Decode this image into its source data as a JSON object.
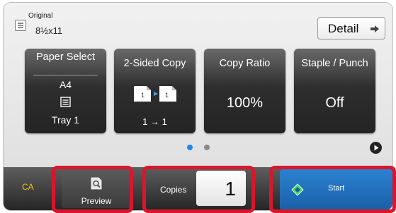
{
  "original": {
    "label": "Original",
    "size": "8½x11",
    "icon": "document-icon"
  },
  "detail": {
    "label": "Detail",
    "icon": "arrow-right-icon"
  },
  "tiles": [
    {
      "title": "Paper Select",
      "subtitle": "A4",
      "icon": "paper-tray-icon",
      "value": "Tray 1"
    },
    {
      "title": "2-Sided Copy",
      "icon": "duplex-icon",
      "value": "1 → 1"
    },
    {
      "title": "Copy Ratio",
      "value": "100%"
    },
    {
      "title": "Staple / Punch",
      "value": "Off"
    }
  ],
  "pagination": {
    "pages": 2,
    "current": 1,
    "next_icon": "play-icon"
  },
  "bottom": {
    "ca_label": "CA",
    "preview_label": "Preview",
    "preview_icon": "magnifier-document-icon",
    "copies_label": "Copies",
    "copies_value": "1",
    "start_label": "Start",
    "start_icon": "diamond-start-icon"
  },
  "colors": {
    "accent_blue": "#1a72c2",
    "ca_yellow": "#f0c419",
    "highlight_red": "#d9162d",
    "dot_active": "#1e88e5",
    "dot_inactive": "#8a8a8a"
  }
}
